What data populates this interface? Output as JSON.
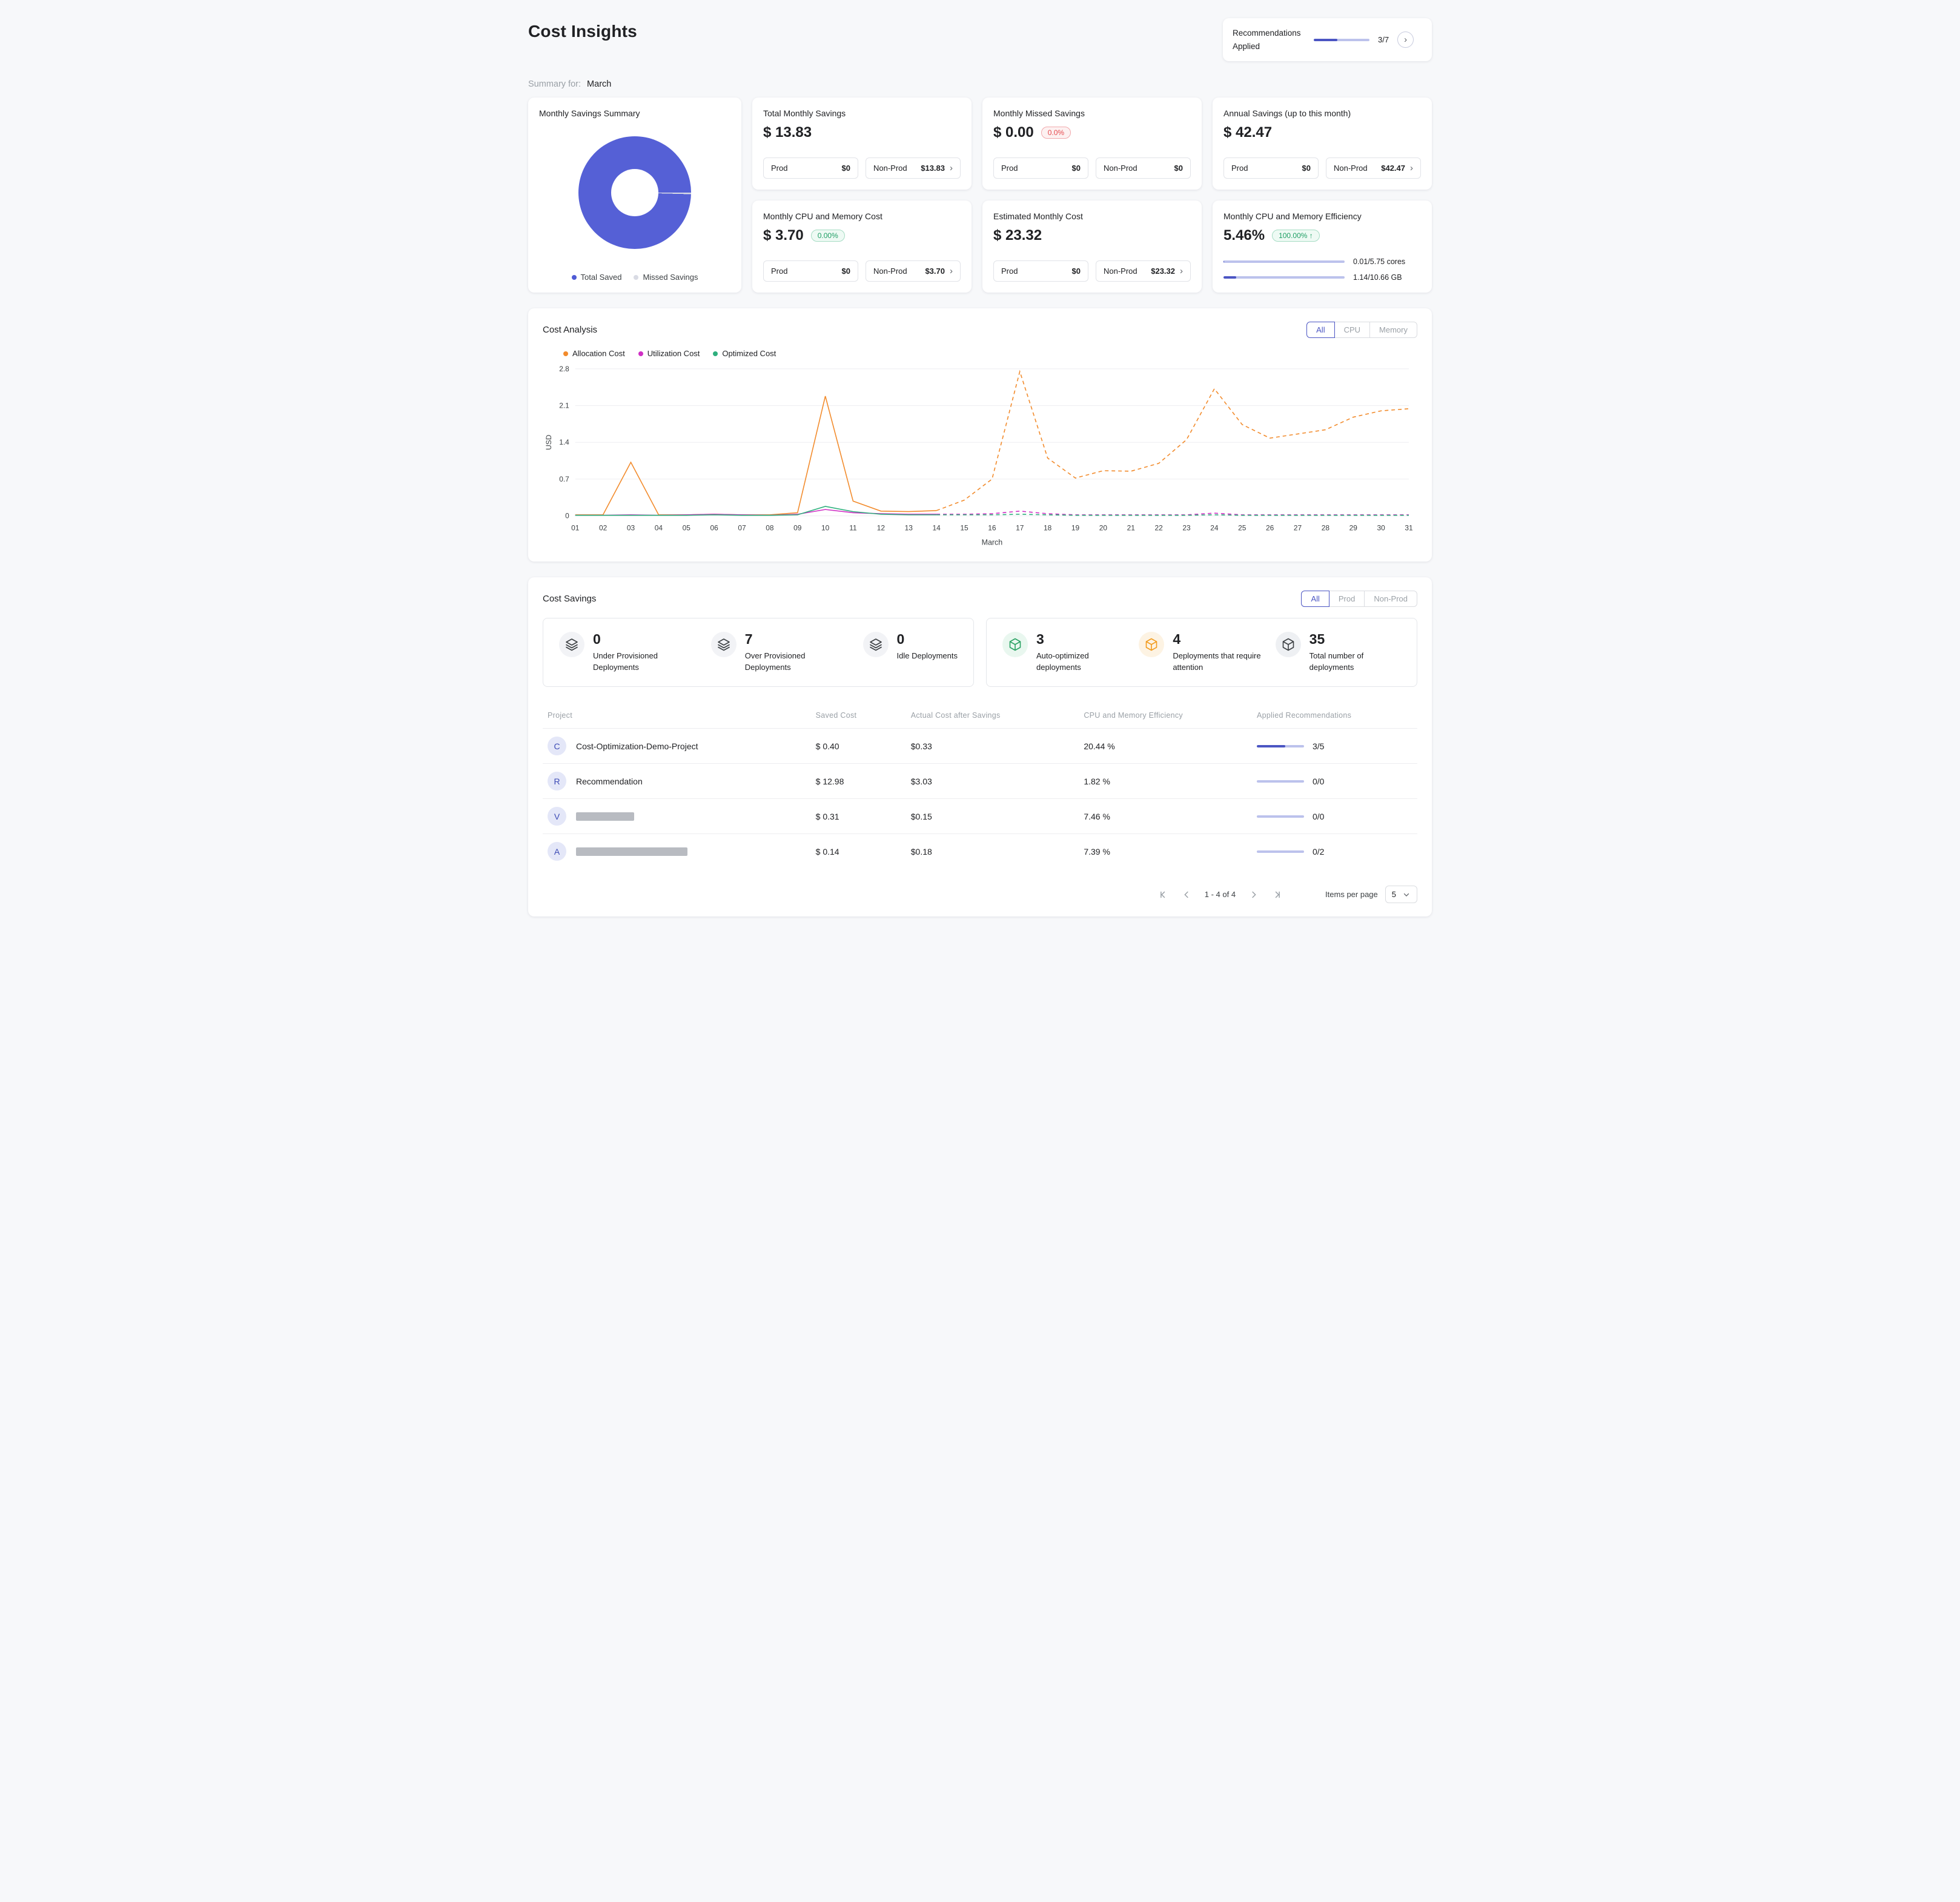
{
  "page": {
    "title": "Cost Insights",
    "summary_for_label": "Summary for:",
    "summary_month": "March"
  },
  "recommendations": {
    "label": "Recommendations Applied",
    "count": "3/7",
    "fraction": 0.4286
  },
  "cards": {
    "savings_summary": {
      "title": "Monthly Savings Summary",
      "total_saved_value": 13.83,
      "missed_value": 0.0,
      "legend": [
        {
          "label": "Total Saved",
          "color": "#4f5bd5"
        },
        {
          "label": "Missed Savings",
          "color": "#d9dbe4"
        }
      ]
    },
    "total_monthly": {
      "title": "Total Monthly Savings",
      "value": "$ 13.83",
      "pills": [
        {
          "label": "Prod",
          "value": "$0"
        },
        {
          "label": "Non-Prod",
          "value": "$13.83"
        }
      ]
    },
    "missed": {
      "title": "Monthly Missed Savings",
      "value": "$ 0.00",
      "badge": "0.0%",
      "pills": [
        {
          "label": "Prod",
          "value": "$0"
        },
        {
          "label": "Non-Prod",
          "value": "$0"
        }
      ]
    },
    "annual": {
      "title": "Annual Savings (up to this month)",
      "value": "$ 42.47",
      "pills": [
        {
          "label": "Prod",
          "value": "$0"
        },
        {
          "label": "Non-Prod",
          "value": "$42.47"
        }
      ]
    },
    "cpu_mem_cost": {
      "title": "Monthly CPU and Memory Cost",
      "value": "$ 3.70",
      "badge": "0.00%",
      "pills": [
        {
          "label": "Prod",
          "value": "$0"
        },
        {
          "label": "Non-Prod",
          "value": "$3.70"
        }
      ]
    },
    "estimated": {
      "title": "Estimated Monthly Cost",
      "value": "$ 23.32",
      "pills": [
        {
          "label": "Prod",
          "value": "$0"
        },
        {
          "label": "Non-Prod",
          "value": "$23.32"
        }
      ]
    },
    "efficiency": {
      "title": "Monthly CPU and Memory Efficiency",
      "value": "5.46%",
      "badge": "100.00% ↑",
      "bars": [
        {
          "fraction": 0.002,
          "label": "0.01/5.75 cores"
        },
        {
          "fraction": 0.107,
          "label": "1.14/10.66 GB"
        }
      ]
    }
  },
  "cost_analysis": {
    "title": "Cost Analysis",
    "tabs": [
      "All",
      "CPU",
      "Memory"
    ],
    "active_tab": "All"
  },
  "chart_data": {
    "type": "line",
    "x": [
      "01",
      "02",
      "03",
      "04",
      "05",
      "06",
      "07",
      "08",
      "09",
      "10",
      "11",
      "12",
      "13",
      "14",
      "15",
      "16",
      "17",
      "18",
      "19",
      "20",
      "21",
      "22",
      "23",
      "24",
      "25",
      "26",
      "27",
      "28",
      "29",
      "30",
      "31"
    ],
    "xlabel": "March",
    "ylabel": "USD",
    "yticks": [
      0,
      0.7,
      1.4,
      2.1,
      2.8
    ],
    "ylim": [
      0,
      2.8
    ],
    "grid": true,
    "legend_position": "top-left",
    "forecast_start_index": 13,
    "series": [
      {
        "name": "Allocation Cost",
        "color": "#f28b2c",
        "values": [
          0.02,
          0.02,
          1.02,
          0.02,
          0.02,
          0.03,
          0.02,
          0.02,
          0.06,
          2.28,
          0.28,
          0.09,
          0.08,
          0.1,
          0.3,
          0.7,
          2.75,
          1.1,
          0.72,
          0.86,
          0.85,
          1.0,
          1.45,
          2.42,
          1.74,
          1.48,
          1.56,
          1.64,
          1.88,
          2.0,
          2.04
        ]
      },
      {
        "name": "Utilization Cost",
        "color": "#cf2fc4",
        "values": [
          0.01,
          0.01,
          0.02,
          0.01,
          0.02,
          0.03,
          0.02,
          0.01,
          0.03,
          0.12,
          0.06,
          0.04,
          0.03,
          0.03,
          0.03,
          0.04,
          0.09,
          0.04,
          0.02,
          0.02,
          0.02,
          0.02,
          0.02,
          0.05,
          0.02,
          0.02,
          0.02,
          0.02,
          0.02,
          0.02,
          0.02
        ]
      },
      {
        "name": "Optimized Cost",
        "color": "#2eaf7d",
        "values": [
          0.01,
          0.01,
          0.01,
          0.01,
          0.01,
          0.02,
          0.01,
          0.01,
          0.02,
          0.18,
          0.08,
          0.03,
          0.02,
          0.02,
          0.02,
          0.02,
          0.03,
          0.02,
          0.01,
          0.01,
          0.01,
          0.01,
          0.01,
          0.02,
          0.01,
          0.01,
          0.01,
          0.01,
          0.01,
          0.01,
          0.01
        ]
      }
    ]
  },
  "cost_savings": {
    "title": "Cost Savings",
    "tabs": [
      "All",
      "Prod",
      "Non-Prod"
    ],
    "active_tab": "All",
    "left_stats": [
      {
        "value": "0",
        "label": "Under Provisioned Deployments",
        "icon": "layers-icon",
        "color": "#3c4043"
      },
      {
        "value": "7",
        "label": "Over Provisioned Deployments",
        "icon": "layers-icon",
        "color": "#3c4043"
      },
      {
        "value": "0",
        "label": "Idle Deployments",
        "icon": "layers-icon",
        "color": "#3c4043"
      }
    ],
    "right_stats": [
      {
        "value": "3",
        "label": "Auto-optimized deployments",
        "icon": "cube-icon",
        "color": "#2aa263"
      },
      {
        "value": "4",
        "label": "Deployments that require attention",
        "icon": "cube-icon",
        "color": "#f29b1d"
      },
      {
        "value": "35",
        "label": "Total number of deployments",
        "icon": "cube-icon",
        "color": "#3c4043"
      }
    ]
  },
  "table": {
    "columns": [
      "Project",
      "Saved Cost",
      "Actual Cost after Savings",
      "CPU and Memory Efficiency",
      "Applied Recommendations"
    ],
    "rows": [
      {
        "avatar": "C",
        "name": "Cost-Optimization-Demo-Project",
        "saved": "$ 0.40",
        "actual": "$0.33",
        "efficiency": "20.44 %",
        "applied": "3/5",
        "fraction": 0.6
      },
      {
        "avatar": "R",
        "name": "Recommendation",
        "saved": "$ 12.98",
        "actual": "$3.03",
        "efficiency": "1.82 %",
        "applied": "0/0",
        "fraction": 0
      },
      {
        "avatar": "V",
        "name": "",
        "saved": "$ 0.31",
        "actual": "$0.15",
        "efficiency": "7.46 %",
        "applied": "0/0",
        "fraction": 0
      },
      {
        "avatar": "A",
        "name": "",
        "saved": "$ 0.14",
        "actual": "$0.18",
        "efficiency": "7.39 %",
        "applied": "0/2",
        "fraction": 0
      }
    ]
  },
  "pagination": {
    "range": "1 - 4 of 4",
    "items_per_page_label": "Items per page",
    "items_per_page": "5"
  }
}
